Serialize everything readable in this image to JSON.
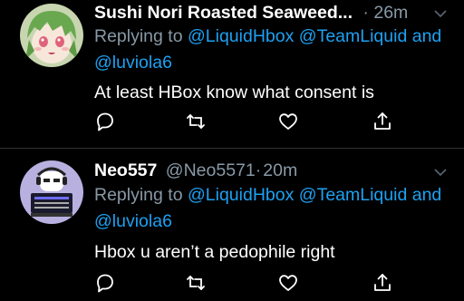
{
  "colors": {
    "background": "#000000",
    "muted": "#8899a6",
    "link": "#1da1f2",
    "divider": "#2f3336"
  },
  "tweets": [
    {
      "display_name": "Sushi Nori Roasted Seaweed...",
      "handle": "",
      "separator": "·",
      "time": "26m",
      "reply_prefix": "Replying to",
      "mentions": [
        "@LiquidHbox",
        "@TeamLiquid",
        "@luviola6"
      ],
      "mention_joiner": "and",
      "text": "At least HBox know what consent is",
      "avatar_icon": "anime-girl-avatar-icon",
      "actions": [
        "reply-icon",
        "retweet-icon",
        "like-icon",
        "share-icon"
      ]
    },
    {
      "display_name": "Neo557",
      "handle": "@Neo5571",
      "separator": "·",
      "time": "20m",
      "reply_prefix": "Replying to",
      "mentions": [
        "@LiquidHbox",
        "@TeamLiquid",
        "@luviola6"
      ],
      "mention_joiner": "and",
      "text": "Hbox u aren’t a pedophile right",
      "avatar_icon": "dj-character-avatar-icon",
      "actions": [
        "reply-icon",
        "retweet-icon",
        "like-icon",
        "share-icon"
      ]
    }
  ]
}
